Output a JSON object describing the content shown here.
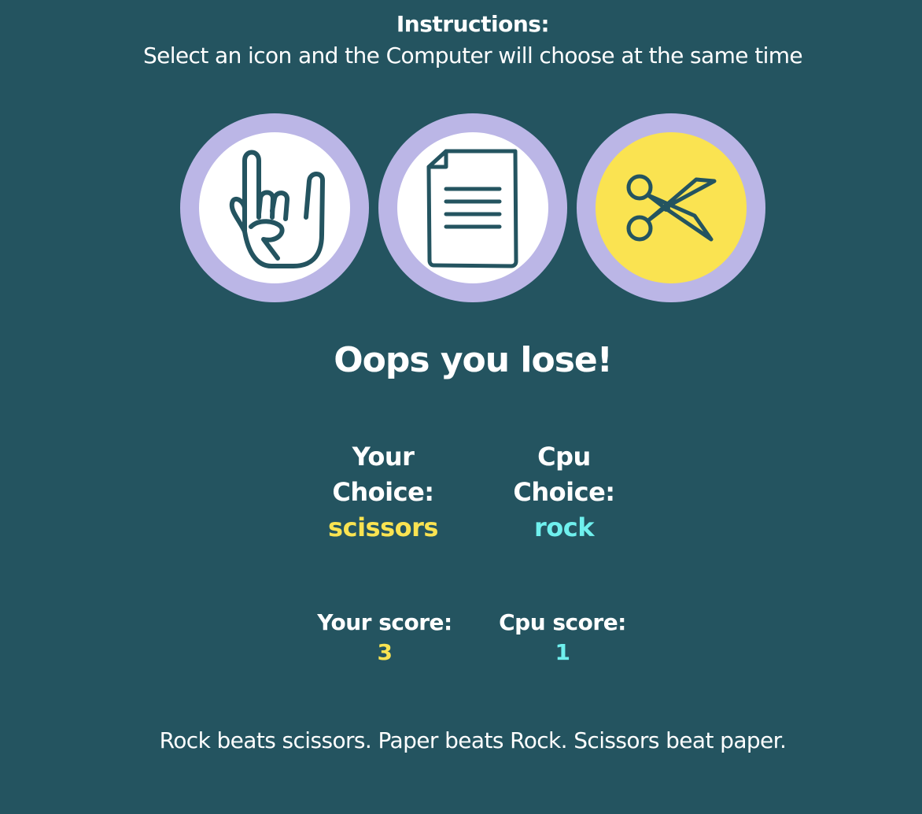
{
  "instructions": {
    "title": "Instructions:",
    "text": "Select an icon and the Computer will choose at the same time"
  },
  "choices": [
    {
      "id": "rock",
      "icon": "rock-hand-icon",
      "selected": false
    },
    {
      "id": "paper",
      "icon": "paper-document-icon",
      "selected": false
    },
    {
      "id": "scissors",
      "icon": "scissors-icon",
      "selected": true
    }
  ],
  "result": "Oops you lose!",
  "player": {
    "choice_label_line1": "Your",
    "choice_label_line2": "Choice:",
    "choice_value": "scissors",
    "score_label": "Your score:",
    "score_value": "3"
  },
  "cpu": {
    "choice_label_line1": "Cpu",
    "choice_label_line2": "Choice:",
    "choice_value": "rock",
    "score_label": "Cpu score:",
    "score_value": "1"
  },
  "rules": "Rock beats scissors. Paper beats Rock. Scissors beat paper.",
  "colors": {
    "background": "#245460",
    "ring": "#bbb6e6",
    "selected_fill": "#fae351",
    "player_accent": "#fae351",
    "cpu_accent": "#6ff0ee",
    "icon_stroke": "#245460"
  }
}
